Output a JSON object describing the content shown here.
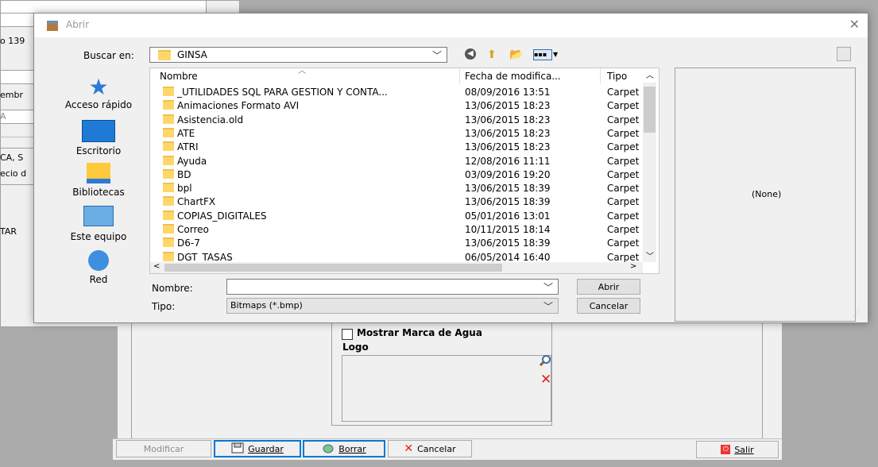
{
  "background_app": {
    "field1": "o 139",
    "field2": "embr",
    "field3": "A",
    "field4": "CA, S",
    "field5": "ecio d",
    "field6": "TAR",
    "watermark_checkbox_label": "Mostrar Marca de Agua",
    "logo_label": "Logo",
    "buttons": {
      "modificar": "Modificar",
      "guardar": "Guardar",
      "borrar": "Borrar",
      "cancelar": "Cancelar",
      "salir": "Salir"
    }
  },
  "dialog": {
    "title": "Abrir",
    "look_in_label": "Buscar en:",
    "look_in_value": "GINSA",
    "places": [
      {
        "label": "Acceso rápido",
        "icon": "star-icon"
      },
      {
        "label": "Escritorio",
        "icon": "desktop-icon"
      },
      {
        "label": "Bibliotecas",
        "icon": "libraries-icon"
      },
      {
        "label": "Este equipo",
        "icon": "computer-icon"
      },
      {
        "label": "Red",
        "icon": "network-icon"
      }
    ],
    "columns": {
      "name": "Nombre",
      "date": "Fecha de modifica...",
      "type": "Tipo"
    },
    "files": [
      {
        "name": "_UTILIDADES SQL PARA GESTION Y CONTA...",
        "date": "08/09/2016 13:51",
        "type": "Carpet"
      },
      {
        "name": "Animaciones Formato AVI",
        "date": "13/06/2015 18:23",
        "type": "Carpet"
      },
      {
        "name": "Asistencia.old",
        "date": "13/06/2015 18:23",
        "type": "Carpet"
      },
      {
        "name": "ATE",
        "date": "13/06/2015 18:23",
        "type": "Carpet"
      },
      {
        "name": "ATRI",
        "date": "13/06/2015 18:23",
        "type": "Carpet"
      },
      {
        "name": "Ayuda",
        "date": "12/08/2016 11:11",
        "type": "Carpet"
      },
      {
        "name": "BD",
        "date": "03/09/2016 19:20",
        "type": "Carpet"
      },
      {
        "name": "bpl",
        "date": "13/06/2015 18:39",
        "type": "Carpet"
      },
      {
        "name": "ChartFX",
        "date": "13/06/2015 18:39",
        "type": "Carpet"
      },
      {
        "name": "COPIAS_DIGITALES",
        "date": "05/01/2016 13:01",
        "type": "Carpet"
      },
      {
        "name": "Correo",
        "date": "10/11/2015 18:14",
        "type": "Carpet"
      },
      {
        "name": "D6-7",
        "date": "13/06/2015 18:39",
        "type": "Carpet"
      },
      {
        "name": "DGT_TASAS",
        "date": "06/05/2014 16:40",
        "type": "Carpet"
      }
    ],
    "filename_label": "Nombre:",
    "filename_value": "",
    "filetype_label": "Tipo:",
    "filetype_value": "Bitmaps (*.bmp)",
    "open_button": "Abrir",
    "cancel_button": "Cancelar",
    "preview_text": "(None)"
  }
}
